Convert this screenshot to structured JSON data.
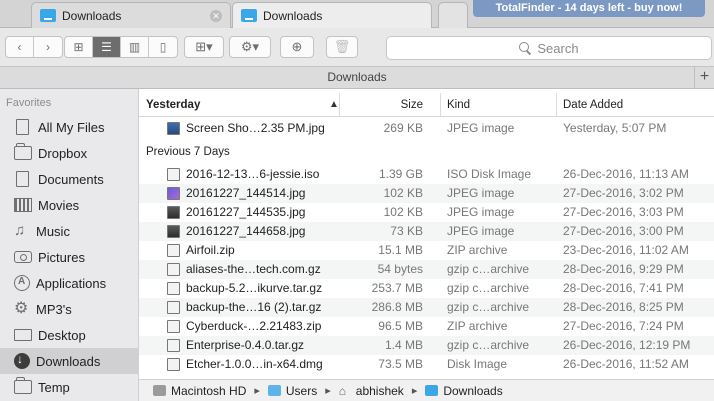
{
  "tabs": [
    {
      "label": "Downloads"
    },
    {
      "label": "Downloads"
    }
  ],
  "promo": "TotalFinder - 14 days left - buy now!",
  "search": {
    "placeholder": "Search"
  },
  "window_title": "Downloads",
  "sidebar": {
    "heading": "Favorites",
    "items": [
      {
        "label": "All My Files",
        "icon": "all-files-icon"
      },
      {
        "label": "Dropbox",
        "icon": "folder-icon"
      },
      {
        "label": "Documents",
        "icon": "document-icon"
      },
      {
        "label": "Movies",
        "icon": "film-icon"
      },
      {
        "label": "Music",
        "icon": "music-icon"
      },
      {
        "label": "Pictures",
        "icon": "camera-icon"
      },
      {
        "label": "Applications",
        "icon": "applications-icon"
      },
      {
        "label": "MP3's",
        "icon": "gear-icon"
      },
      {
        "label": "Desktop",
        "icon": "desktop-icon"
      },
      {
        "label": "Downloads",
        "icon": "download-icon"
      },
      {
        "label": "Temp",
        "icon": "folder-icon"
      }
    ]
  },
  "columns": {
    "name": "Yesterday",
    "size": "Size",
    "kind": "Kind",
    "date": "Date Added"
  },
  "sections": {
    "yesterday_files": [
      {
        "name": "Screen Sho…2.35 PM.jpg",
        "size": "269 KB",
        "kind": "JPEG image",
        "date": "Yesterday, 5:07 PM",
        "icon": "screenshot"
      }
    ],
    "previous_label": "Previous 7 Days",
    "previous_files": [
      {
        "name": "2016-12-13…6-jessie.iso",
        "size": "1.39 GB",
        "kind": "ISO Disk Image",
        "date": "26-Dec-2016, 11:13 AM",
        "icon": "doc"
      },
      {
        "name": "20161227_144514.jpg",
        "size": "102 KB",
        "kind": "JPEG image",
        "date": "27-Dec-2016, 3:02 PM",
        "icon": "purple"
      },
      {
        "name": "20161227_144535.jpg",
        "size": "102 KB",
        "kind": "JPEG image",
        "date": "27-Dec-2016, 3:03 PM",
        "icon": "img"
      },
      {
        "name": "20161227_144658.jpg",
        "size": "73 KB",
        "kind": "JPEG image",
        "date": "27-Dec-2016, 3:00 PM",
        "icon": "img"
      },
      {
        "name": "Airfoil.zip",
        "size": "15.1 MB",
        "kind": "ZIP archive",
        "date": "23-Dec-2016, 11:02 AM",
        "icon": "doc"
      },
      {
        "name": "aliases-the…tech.com.gz",
        "size": "54 bytes",
        "kind": "gzip c…archive",
        "date": "28-Dec-2016, 9:29 PM",
        "icon": "doc"
      },
      {
        "name": "backup-5.2…ikurve.tar.gz",
        "size": "253.7 MB",
        "kind": "gzip c…archive",
        "date": "28-Dec-2016, 7:41 PM",
        "icon": "doc"
      },
      {
        "name": "backup-the…16 (2).tar.gz",
        "size": "286.8 MB",
        "kind": "gzip c…archive",
        "date": "28-Dec-2016, 8:25 PM",
        "icon": "doc"
      },
      {
        "name": "Cyberduck-…2.21483.zip",
        "size": "96.5 MB",
        "kind": "ZIP archive",
        "date": "27-Dec-2016, 7:24 PM",
        "icon": "doc"
      },
      {
        "name": "Enterprise-0.4.0.tar.gz",
        "size": "1.4 MB",
        "kind": "gzip c…archive",
        "date": "26-Dec-2016, 12:19 PM",
        "icon": "doc"
      },
      {
        "name": "Etcher-1.0.0…in-x64.dmg",
        "size": "73.5 MB",
        "kind": "Disk Image",
        "date": "26-Dec-2016, 11:52 AM",
        "icon": "doc"
      }
    ]
  },
  "pathbar": [
    "Macintosh HD",
    "Users",
    "abhishek",
    "Downloads"
  ]
}
